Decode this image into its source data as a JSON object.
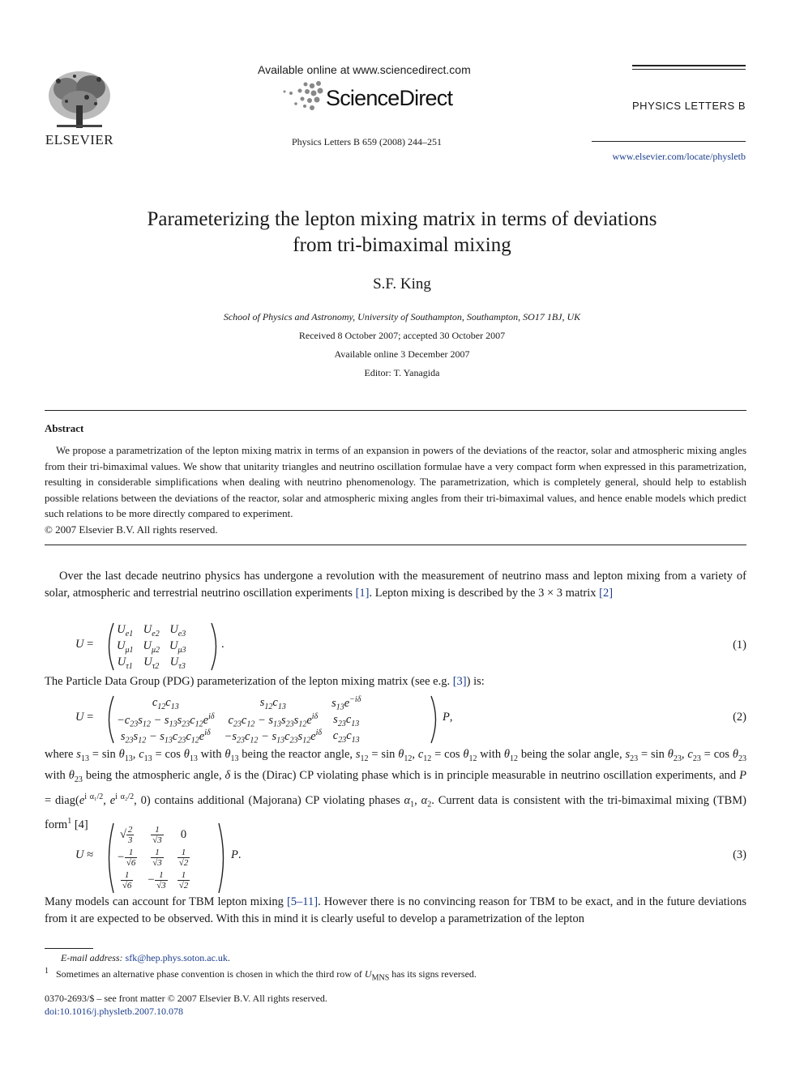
{
  "header": {
    "publisher_name": "ELSEVIER",
    "available_online_text": "Available online at www.sciencedirect.com",
    "sciencedirect_brand": "ScienceDirect",
    "journal_citation": "Physics Letters B 659 (2008) 244–251",
    "journal_name": "PHYSICS LETTERS B",
    "journal_url": "www.elsevier.com/locate/physletb"
  },
  "article": {
    "title_line1": "Parameterizing the lepton mixing matrix in terms of deviations",
    "title_line2": "from tri-bimaximal mixing",
    "author": "S.F. King",
    "affiliation": "School of Physics and Astronomy, University of Southampton, Southampton, SO17 1BJ, UK",
    "received": "Received 8 October 2007; accepted 30 October 2007",
    "available_online": "Available online 3 December 2007",
    "editor": "Editor: T. Yanagida"
  },
  "abstract": {
    "heading": "Abstract",
    "text": "We propose a parametrization of the lepton mixing matrix in terms of an expansion in powers of the deviations of the reactor, solar and atmospheric mixing angles from their tri-bimaximal values. We show that unitarity triangles and neutrino oscillation formulae have a very compact form when expressed in this parametrization, resulting in considerable simplifications when dealing with neutrino phenomenology. The parametrization, which is completely general, should help to establish possible relations between the deviations of the reactor, solar and atmospheric mixing angles from their tri-bimaximal values, and hence enable models which predict such relations to be more directly compared to experiment.",
    "copyright": "© 2007 Elsevier B.V. All rights reserved."
  },
  "body": {
    "p1_a": "Over the last decade neutrino physics has undergone a revolution with the measurement of neutrino mass and lepton mixing from a variety of solar, atmospheric and terrestrial neutrino oscillation experiments ",
    "p1_ref1": "[1]",
    "p1_b": ". Lepton mixing is described by the 3 × 3 matrix ",
    "p1_ref2": "[2]",
    "p2_a": "The Particle Data Group (PDG) parameterization of the lepton mixing matrix (see e.g. ",
    "p2_ref": "[3]",
    "p2_b": ") is:",
    "p3_a": "where ",
    "p3_b": " being the reactor angle, ",
    "p3_c": " being the solar angle, ",
    "p3_d": " being the atmospheric angle, ",
    "p3_e": " is the (Dirac) CP violating phase which is in principle measurable in neutrino oscillation experiments, and ",
    "p3_f": " contains additional (Majorana) CP violating phases ",
    "p3_g": ". Current data is consistent with the tri-bimaximal mixing (TBM) form",
    "p3_fnmark": "1",
    "p3_ref": "[4]",
    "p4_a": "Many models can account for TBM lepton mixing ",
    "p4_ref": "[5–11]",
    "p4_b": ". However there is no convincing reason for TBM to be exact, and in the future deviations from it are expected to be observed. With this in mind it is clearly useful to develop a parametrization of the lepton"
  },
  "equations": {
    "eq1_number": "(1)",
    "eq2_number": "(2)",
    "eq3_number": "(3)",
    "eq1": [
      [
        "U_e1",
        "U_e2",
        "U_e3"
      ],
      [
        "U_μ1",
        "U_μ2",
        "U_μ3"
      ],
      [
        "U_τ1",
        "U_τ2",
        "U_τ3"
      ]
    ],
    "eq2": [
      [
        "c12c13",
        "s12c13",
        "s13e^{-iδ}"
      ],
      [
        "-c23s12 - s13s23c12e^{iδ}",
        "c23c12 - s13s23s12e^{iδ}",
        "s23c13"
      ],
      [
        "s23s12 - s13c23c12e^{iδ}",
        "-s23c12 - s13c23s12e^{iδ}",
        "c23c13"
      ]
    ],
    "eq3": [
      [
        "√(2/3)",
        "1/√3",
        "0"
      ],
      [
        "-1/√6",
        "1/√3",
        "1/√2"
      ],
      [
        "1/√6",
        "-1/√3",
        "1/√2"
      ]
    ]
  },
  "footnotes": {
    "email_label": "E-mail address:",
    "email": "sfk@hep.phys.soton.ac.uk",
    "fn1_mark": "1",
    "fn1_text_a": "Sometimes an alternative phase convention is chosen in which the third row of ",
    "fn1_text_b": " has its signs reversed.",
    "front_matter": "0370-2693/$ – see front matter  © 2007 Elsevier B.V. All rights reserved.",
    "doi": "doi:10.1016/j.physletb.2007.10.078"
  }
}
